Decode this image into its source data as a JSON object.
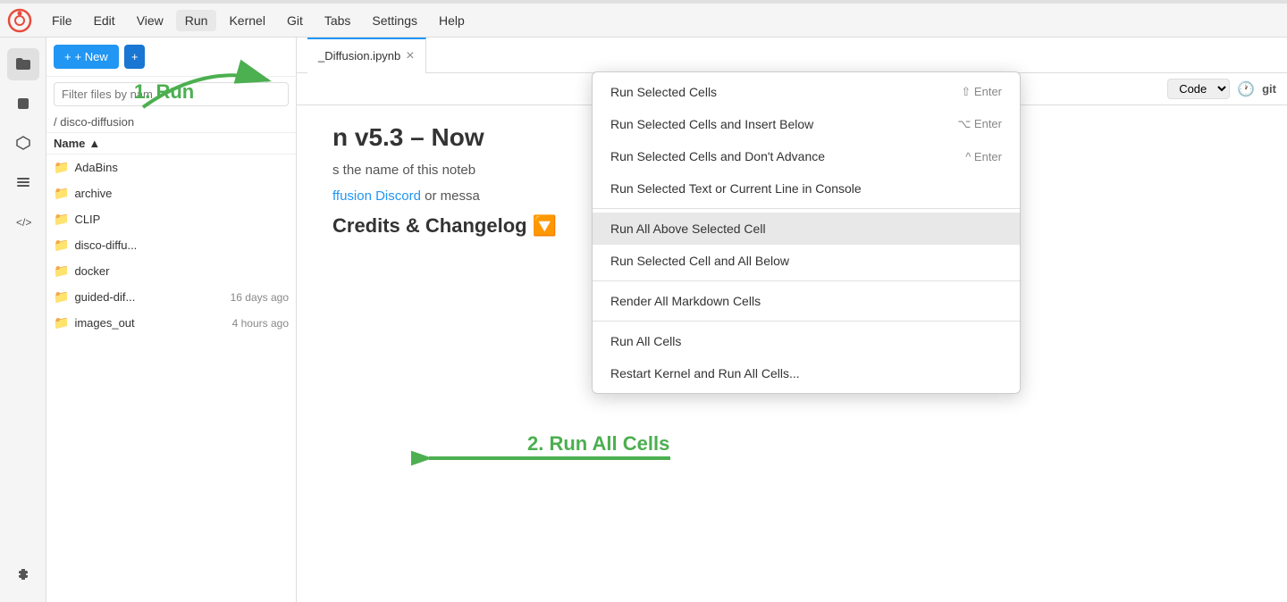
{
  "titleBar": {},
  "menuBar": {
    "logo": "◎",
    "items": [
      "File",
      "Edit",
      "View",
      "Run",
      "Kernel",
      "Git",
      "Tabs",
      "Settings",
      "Help"
    ]
  },
  "iconSidebar": {
    "icons": [
      {
        "name": "folder-icon",
        "symbol": "📁"
      },
      {
        "name": "stop-icon",
        "symbol": "⏹"
      },
      {
        "name": "git-icon",
        "symbol": "◇"
      },
      {
        "name": "list-icon",
        "symbol": "≡"
      },
      {
        "name": "code-icon",
        "symbol": "</>"
      },
      {
        "name": "puzzle-icon",
        "symbol": "🧩"
      }
    ]
  },
  "filePanel": {
    "newButton": "+ New",
    "newIconButton": "+",
    "filterPlaceholder": "Filter files by nam",
    "breadcrumb": "/ disco-diffusion",
    "columns": {
      "name": "Name",
      "sort": "▲"
    },
    "files": [
      {
        "name": "AdaBins",
        "type": "folder",
        "time": ""
      },
      {
        "name": "archive",
        "type": "folder",
        "time": ""
      },
      {
        "name": "CLIP",
        "type": "folder",
        "time": ""
      },
      {
        "name": "disco-diffu...",
        "type": "folder",
        "time": ""
      },
      {
        "name": "docker",
        "type": "folder",
        "time": ""
      },
      {
        "name": "guided-dif...",
        "type": "folder",
        "time": ""
      },
      {
        "name": "images_out",
        "type": "folder",
        "time": "4 hours ago"
      }
    ]
  },
  "notebookTab": {
    "title": "_Diffusion.ipynb",
    "close": "×"
  },
  "toolbar": {
    "cellType": "Code",
    "clockIcon": "🕐",
    "gitLabel": "git"
  },
  "notebookContent": {
    "titlePartial": "n v5.3 – Now",
    "textPartial": "s the name of this noteb",
    "linkText": "ffusion Discord",
    "linkSuffix": " or messa",
    "sectionTitle": "Credits & Changelog 🔽"
  },
  "runMenu": {
    "items": [
      {
        "label": "Run Selected Cells",
        "shortcut": "⇧ Enter",
        "highlighted": false,
        "separator_after": false
      },
      {
        "label": "Run Selected Cells and Insert Below",
        "shortcut": "⌥ Enter",
        "highlighted": false,
        "separator_after": false
      },
      {
        "label": "Run Selected Cells and Don't Advance",
        "shortcut": "^ Enter",
        "highlighted": false,
        "separator_after": false
      },
      {
        "label": "Run Selected Text or Current Line in Console",
        "shortcut": "",
        "highlighted": false,
        "separator_after": true
      },
      {
        "label": "Run All Above Selected Cell",
        "shortcut": "",
        "highlighted": true,
        "separator_after": false
      },
      {
        "label": "Run Selected Cell and All Below",
        "shortcut": "",
        "highlighted": false,
        "separator_after": true
      },
      {
        "label": "Render All Markdown Cells",
        "shortcut": "",
        "highlighted": false,
        "separator_after": true
      },
      {
        "label": "Run All Cells",
        "shortcut": "",
        "highlighted": false,
        "separator_after": false
      },
      {
        "label": "Restart Kernel and Run All Cells...",
        "shortcut": "",
        "highlighted": false,
        "separator_after": false
      }
    ]
  },
  "annotations": {
    "arrow1Label": "1. Run",
    "arrow2Label": "2. Run All Cells"
  }
}
